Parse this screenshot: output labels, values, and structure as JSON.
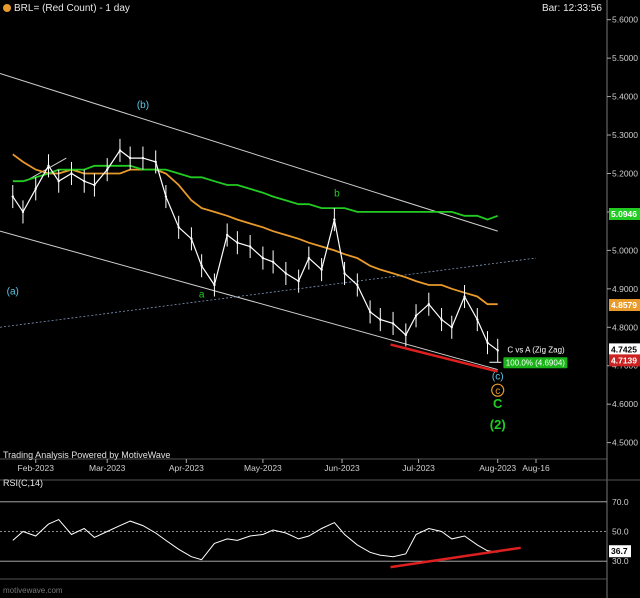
{
  "header": {
    "title": "BRL= (Red Count) - 1 day",
    "bar_time": "Bar: 12:33:56",
    "credit": "Trading Analysis Powered by MotiveWave",
    "watermark": "motivewave.com"
  },
  "chart_data": [
    {
      "type": "line",
      "symbol": "BRL=",
      "x": [
        "2023-01-23",
        "2023-01-27",
        "2023-02-01",
        "2023-02-06",
        "2023-02-10",
        "2023-02-15",
        "2023-02-20",
        "2023-02-24",
        "2023-03-01",
        "2023-03-06",
        "2023-03-10",
        "2023-03-15",
        "2023-03-20",
        "2023-03-24",
        "2023-03-29",
        "2023-04-03",
        "2023-04-07",
        "2023-04-12",
        "2023-04-17",
        "2023-04-21",
        "2023-04-26",
        "2023-05-01",
        "2023-05-05",
        "2023-05-10",
        "2023-05-15",
        "2023-05-19",
        "2023-05-24",
        "2023-05-29",
        "2023-06-02",
        "2023-06-07",
        "2023-06-12",
        "2023-06-16",
        "2023-06-21",
        "2023-06-26",
        "2023-06-30",
        "2023-07-05",
        "2023-07-10",
        "2023-07-14",
        "2023-07-19",
        "2023-07-24",
        "2023-07-28",
        "2023-08-01"
      ],
      "series": [
        {
          "values": [
            5.14,
            5.1,
            5.16,
            5.22,
            5.18,
            5.2,
            5.18,
            5.17,
            5.21,
            5.26,
            5.24,
            5.24,
            5.23,
            5.14,
            5.06,
            5.03,
            4.96,
            4.91,
            5.04,
            5.02,
            5.01,
            4.98,
            4.97,
            4.94,
            4.92,
            4.98,
            4.95,
            5.08,
            4.94,
            4.91,
            4.84,
            4.82,
            4.81,
            4.78,
            4.83,
            4.86,
            4.82,
            4.8,
            4.88,
            4.82,
            4.76,
            4.74
          ],
          "color": "#ffffff"
        },
        {
          "values": [
            5.18,
            5.18,
            5.19,
            5.2,
            5.21,
            5.21,
            5.21,
            5.22,
            5.22,
            5.22,
            5.22,
            5.21,
            5.21,
            5.21,
            5.2,
            5.19,
            5.19,
            5.18,
            5.17,
            5.17,
            5.16,
            5.15,
            5.14,
            5.13,
            5.12,
            5.12,
            5.11,
            5.11,
            5.11,
            5.1,
            5.1,
            5.1,
            5.1,
            5.1,
            5.1,
            5.1,
            5.1,
            5.1,
            5.09,
            5.09,
            5.08,
            5.09
          ],
          "color": "#22cc22"
        },
        {
          "values": [
            5.25,
            5.23,
            5.21,
            5.2,
            5.2,
            5.21,
            5.2,
            5.2,
            5.2,
            5.2,
            5.21,
            5.21,
            5.21,
            5.2,
            5.17,
            5.13,
            5.11,
            5.1,
            5.09,
            5.08,
            5.07,
            5.06,
            5.05,
            5.04,
            5.03,
            5.02,
            5.01,
            5.0,
            4.99,
            4.98,
            4.96,
            4.95,
            4.94,
            4.93,
            4.92,
            4.91,
            4.91,
            4.9,
            4.89,
            4.88,
            4.86,
            4.86
          ],
          "color": "#e89a2a"
        }
      ],
      "price_scale": {
        "ticks": [
          "5.6000",
          "5.5000",
          "5.4000",
          "5.3000",
          "5.2000",
          "5.1000",
          "5.0000",
          "4.9000",
          "4.8000",
          "4.7000",
          "4.6000",
          "4.5000"
        ],
        "markers": [
          {
            "value": 5.0946,
            "label": "5.0946",
            "color": "#22cc22"
          },
          {
            "value": 4.8579,
            "label": "4.8579",
            "color": "#e89a2a"
          },
          {
            "value": 4.7425,
            "label": "4.7425",
            "color": "#ffffff"
          },
          {
            "value": 4.7139,
            "label": "4.7139",
            "color": "#cc2222"
          }
        ]
      },
      "time_axis": [
        "Feb-2023",
        "Mar-2023",
        "Apr-2023",
        "May-2023",
        "Jun-2023",
        "Jul-2023",
        "Aug-2023",
        "Aug-16"
      ],
      "wave_labels": [
        {
          "text": "(a)",
          "date": "2023-01-23",
          "value": 4.885,
          "color": "#5bc8e8"
        },
        {
          "text": "(b)",
          "date": "2023-03-15",
          "value": 5.37,
          "color": "#5bc8e8"
        },
        {
          "text": "a",
          "date": "2023-04-07",
          "value": 4.877,
          "color": "#22cc22"
        },
        {
          "text": "b",
          "date": "2023-05-30",
          "value": 5.14,
          "color": "#22cc22"
        },
        {
          "text": "(c)",
          "date": "2023-08-01",
          "value": 4.664,
          "color": "#5bc8e8"
        },
        {
          "text": "c",
          "date": "2023-08-01",
          "value": 4.626,
          "color": "#e89a2a"
        },
        {
          "text": "C",
          "date": "2023-08-01",
          "value": 4.59,
          "color": "#22cc22"
        },
        {
          "text": "(2)",
          "date": "2023-08-01",
          "value": 4.536,
          "color": "#22cc22"
        }
      ],
      "annotation": {
        "title": "C vs A (Zig Zag)",
        "value": "100.0% (4.6904)"
      }
    },
    {
      "type": "line",
      "title": "RSI(C,14)",
      "x": [
        "2023-01-23",
        "2023-01-27",
        "2023-02-01",
        "2023-02-06",
        "2023-02-10",
        "2023-02-15",
        "2023-02-20",
        "2023-02-24",
        "2023-03-01",
        "2023-03-06",
        "2023-03-10",
        "2023-03-15",
        "2023-03-20",
        "2023-03-24",
        "2023-03-29",
        "2023-04-03",
        "2023-04-07",
        "2023-04-12",
        "2023-04-17",
        "2023-04-21",
        "2023-04-26",
        "2023-05-01",
        "2023-05-05",
        "2023-05-10",
        "2023-05-15",
        "2023-05-19",
        "2023-05-24",
        "2023-05-29",
        "2023-06-02",
        "2023-06-07",
        "2023-06-12",
        "2023-06-16",
        "2023-06-21",
        "2023-06-26",
        "2023-06-30",
        "2023-07-05",
        "2023-07-10",
        "2023-07-14",
        "2023-07-19",
        "2023-07-24",
        "2023-07-28",
        "2023-08-01"
      ],
      "values": [
        44,
        50,
        47,
        55,
        58,
        48,
        52,
        46,
        50,
        54,
        57,
        54,
        49,
        44,
        38,
        33,
        31,
        42,
        45,
        44,
        47,
        48,
        51,
        49,
        45,
        47,
        52,
        56,
        48,
        41,
        36,
        34,
        33,
        35,
        48,
        52,
        50,
        45,
        47,
        41,
        37,
        36
      ],
      "ylim": [
        20,
        80
      ],
      "ticks": [
        "70.0",
        "50.0",
        "30.0"
      ],
      "guides": [
        70,
        50,
        30
      ],
      "current_value": "36.7"
    }
  ],
  "colors": {
    "background": "#000000",
    "price": "#ffffff",
    "ma_green": "#22cc22",
    "ma_orange": "#e89a2a",
    "trend": "#cc2222",
    "wave_cyan": "#5bc8e8"
  }
}
